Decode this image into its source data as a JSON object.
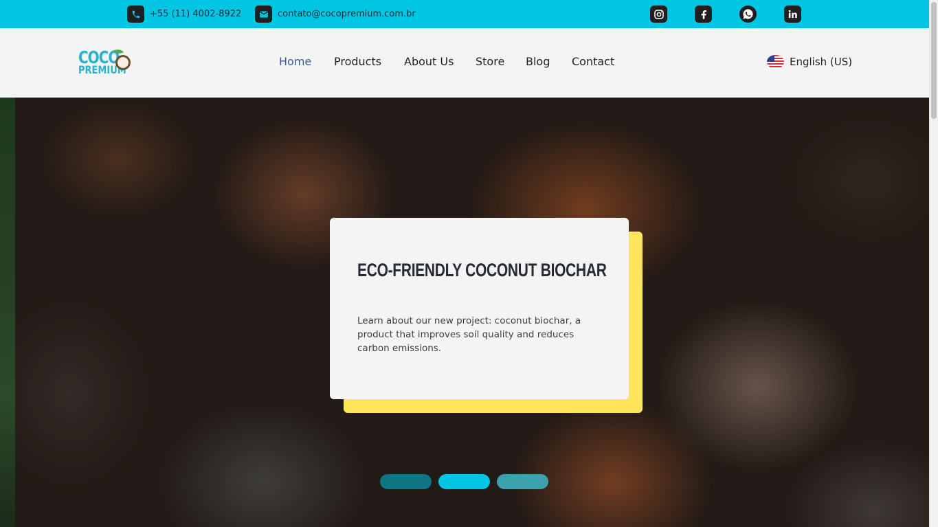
{
  "topbar": {
    "phone": {
      "icon": "phone-icon",
      "text": "+55 (11) 4002-8922"
    },
    "email": {
      "icon": "mail-icon",
      "text": "contato@cocopremium.com.br"
    },
    "social": [
      "instagram-icon",
      "facebook-icon",
      "whatsapp-icon",
      "linkedin-icon"
    ],
    "color": "#00c5e3"
  },
  "header": {
    "logo": {
      "line1": "COCO",
      "line2": "PREMIUM"
    },
    "nav": [
      {
        "label": "Home",
        "active": true
      },
      {
        "label": "Products",
        "active": false
      },
      {
        "label": "About Us",
        "active": false
      },
      {
        "label": "Store",
        "active": false
      },
      {
        "label": "Blog",
        "active": false
      },
      {
        "label": "Contact",
        "active": false
      }
    ],
    "language": {
      "icon": "us-flag-icon",
      "label": "English (US)"
    }
  },
  "hero": {
    "title": "ECO-FRIENDLY COCONUT BIOCHAR",
    "body": "Learn about our new project: coconut biochar, a product that improves soil quality and reduces carbon emissions.",
    "card_accent_color": "#ffe45c",
    "slider": {
      "count": 3,
      "active_index": 1,
      "active_color": "#00c5e3"
    }
  }
}
